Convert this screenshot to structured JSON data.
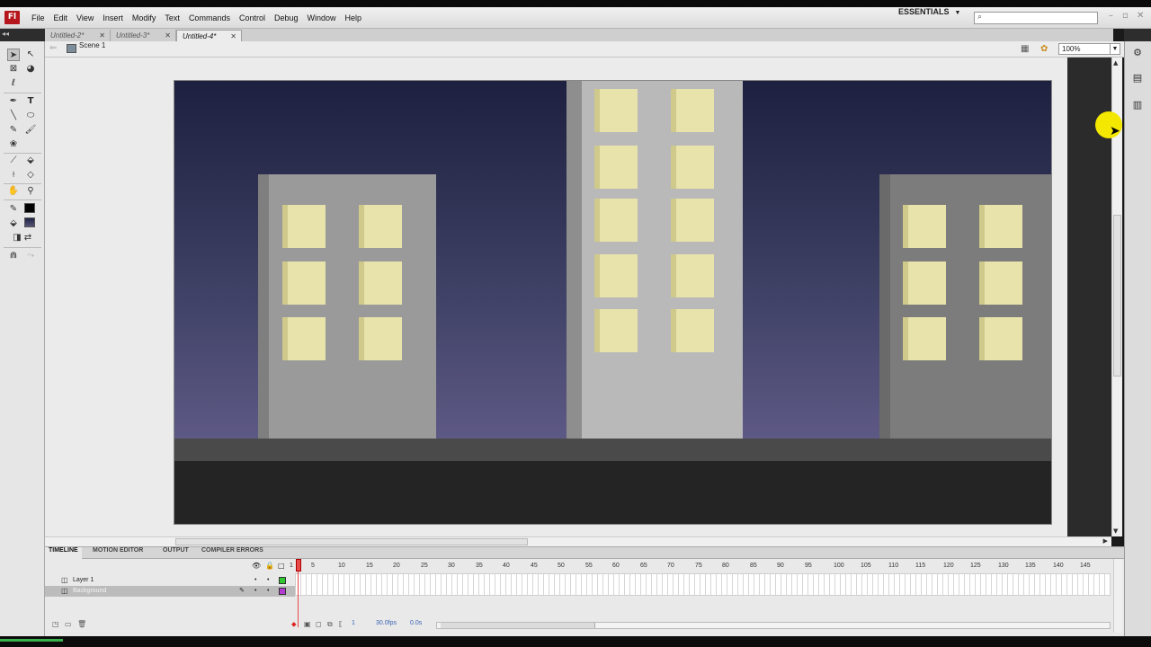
{
  "app": {
    "logo_text": "Fl"
  },
  "menu": [
    "File",
    "Edit",
    "View",
    "Insert",
    "Modify",
    "Text",
    "Commands",
    "Control",
    "Debug",
    "Window",
    "Help"
  ],
  "workspace": {
    "label": "ESSENTIALS"
  },
  "search": {
    "placeholder": ""
  },
  "tabs": [
    {
      "label": "Untitled-2*",
      "active": false
    },
    {
      "label": "Untitled-3*",
      "active": false
    },
    {
      "label": "Untitled-4*",
      "active": true
    }
  ],
  "editbar": {
    "scene": "Scene 1",
    "zoom": "100%"
  },
  "stage": {
    "colors": {
      "sky_top": "#1e2040",
      "sky_bottom": "#615b88",
      "building_light": "#b9b9b9",
      "building_mid": "#9a9a9a",
      "building_dark": "#7c7c7c",
      "window": "#e8e3aa",
      "ground": "#242424"
    }
  },
  "timeline": {
    "tabs": [
      "TIMELINE",
      "MOTION EDITOR",
      "OUTPUT",
      "COMPILER ERRORS"
    ],
    "frame_numbers": [
      "1",
      "5",
      "10",
      "15",
      "20",
      "25",
      "30",
      "35",
      "40",
      "45",
      "50",
      "55",
      "60",
      "65",
      "70",
      "75",
      "80",
      "85",
      "90",
      "95",
      "100",
      "105",
      "110",
      "115",
      "120",
      "125",
      "130",
      "135",
      "140",
      "145"
    ],
    "layers": [
      {
        "name": "Layer 1",
        "selected": false,
        "color": "#2fc92f"
      },
      {
        "name": "Background",
        "selected": true,
        "color": "#b43bd1"
      }
    ],
    "footer": {
      "current_frame": "1",
      "fps": "30.0fps",
      "time": "0.0s"
    }
  }
}
